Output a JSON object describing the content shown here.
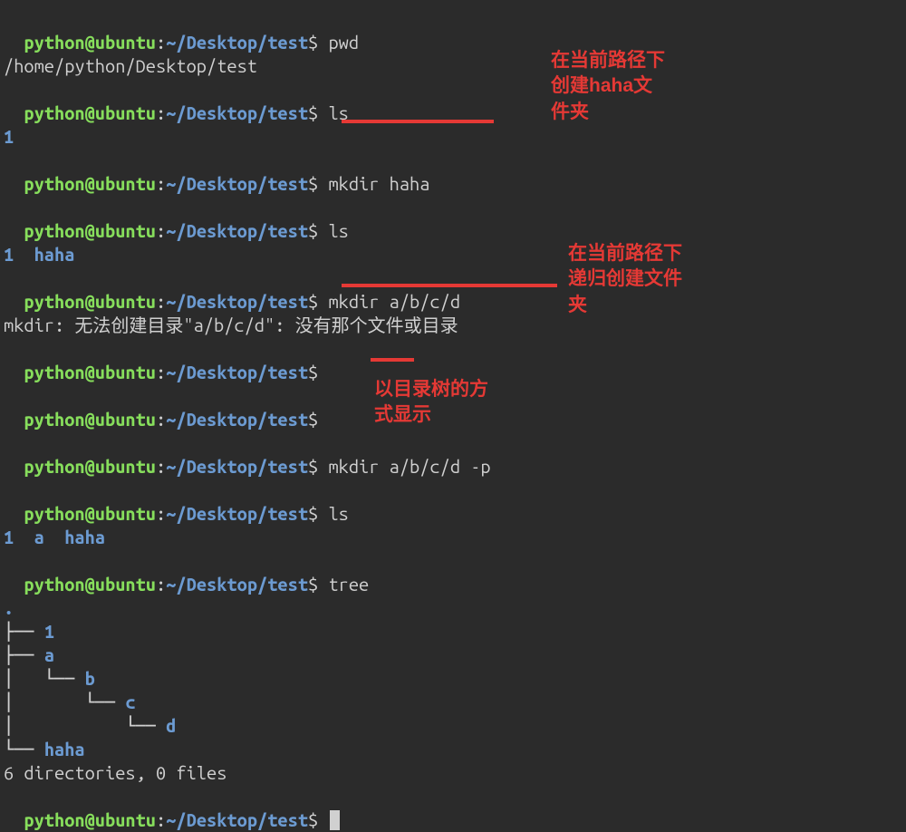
{
  "prompt": {
    "user": "python@ubuntu",
    "sep1": ":",
    "path": "~/Desktop/test",
    "sep2": "$ "
  },
  "lines": {
    "l1_cmd": "pwd",
    "l2_out": "/home/python/Desktop/test",
    "l3_cmd": "ls",
    "l4_out": "1",
    "l5_cmd": "mkdir haha",
    "l6_cmd": "ls",
    "l7_out_a": "1  ",
    "l7_out_b": "haha",
    "l8_cmd": "mkdir a/b/c/d",
    "l9_out": "mkdir: 无法创建目录\"a/b/c/d\": 没有那个文件或目录",
    "l10_cmd": "",
    "l11_cmd": "",
    "l12_cmd": "mkdir a/b/c/d -p",
    "l13_cmd": "ls",
    "l14_out_a": "1  ",
    "l14_out_b": "a  ",
    "l14_out_c": "haha",
    "l15_cmd": "tree",
    "tree_dot": ".",
    "tree_1": "├── 1",
    "tree_a": "├── a",
    "tree_b": "│   └── b",
    "tree_c": "│       └── c",
    "tree_d": "│           └── d",
    "tree_haha": "└── haha",
    "tree_blank": "",
    "tree_summary": "6 directories, 0 files",
    "l_last_cmd": ""
  },
  "tree_names": {
    "n1": "1",
    "na": "a",
    "nb": "b",
    "nc": "c",
    "nd": "d",
    "nhaha": "haha"
  },
  "annotations": {
    "a1": "在当前路径下\n创建haha文\n件夹",
    "a2": "在当前路径下\n递归创建文件\n夹",
    "a3": "以目录树的方\n式显示"
  }
}
